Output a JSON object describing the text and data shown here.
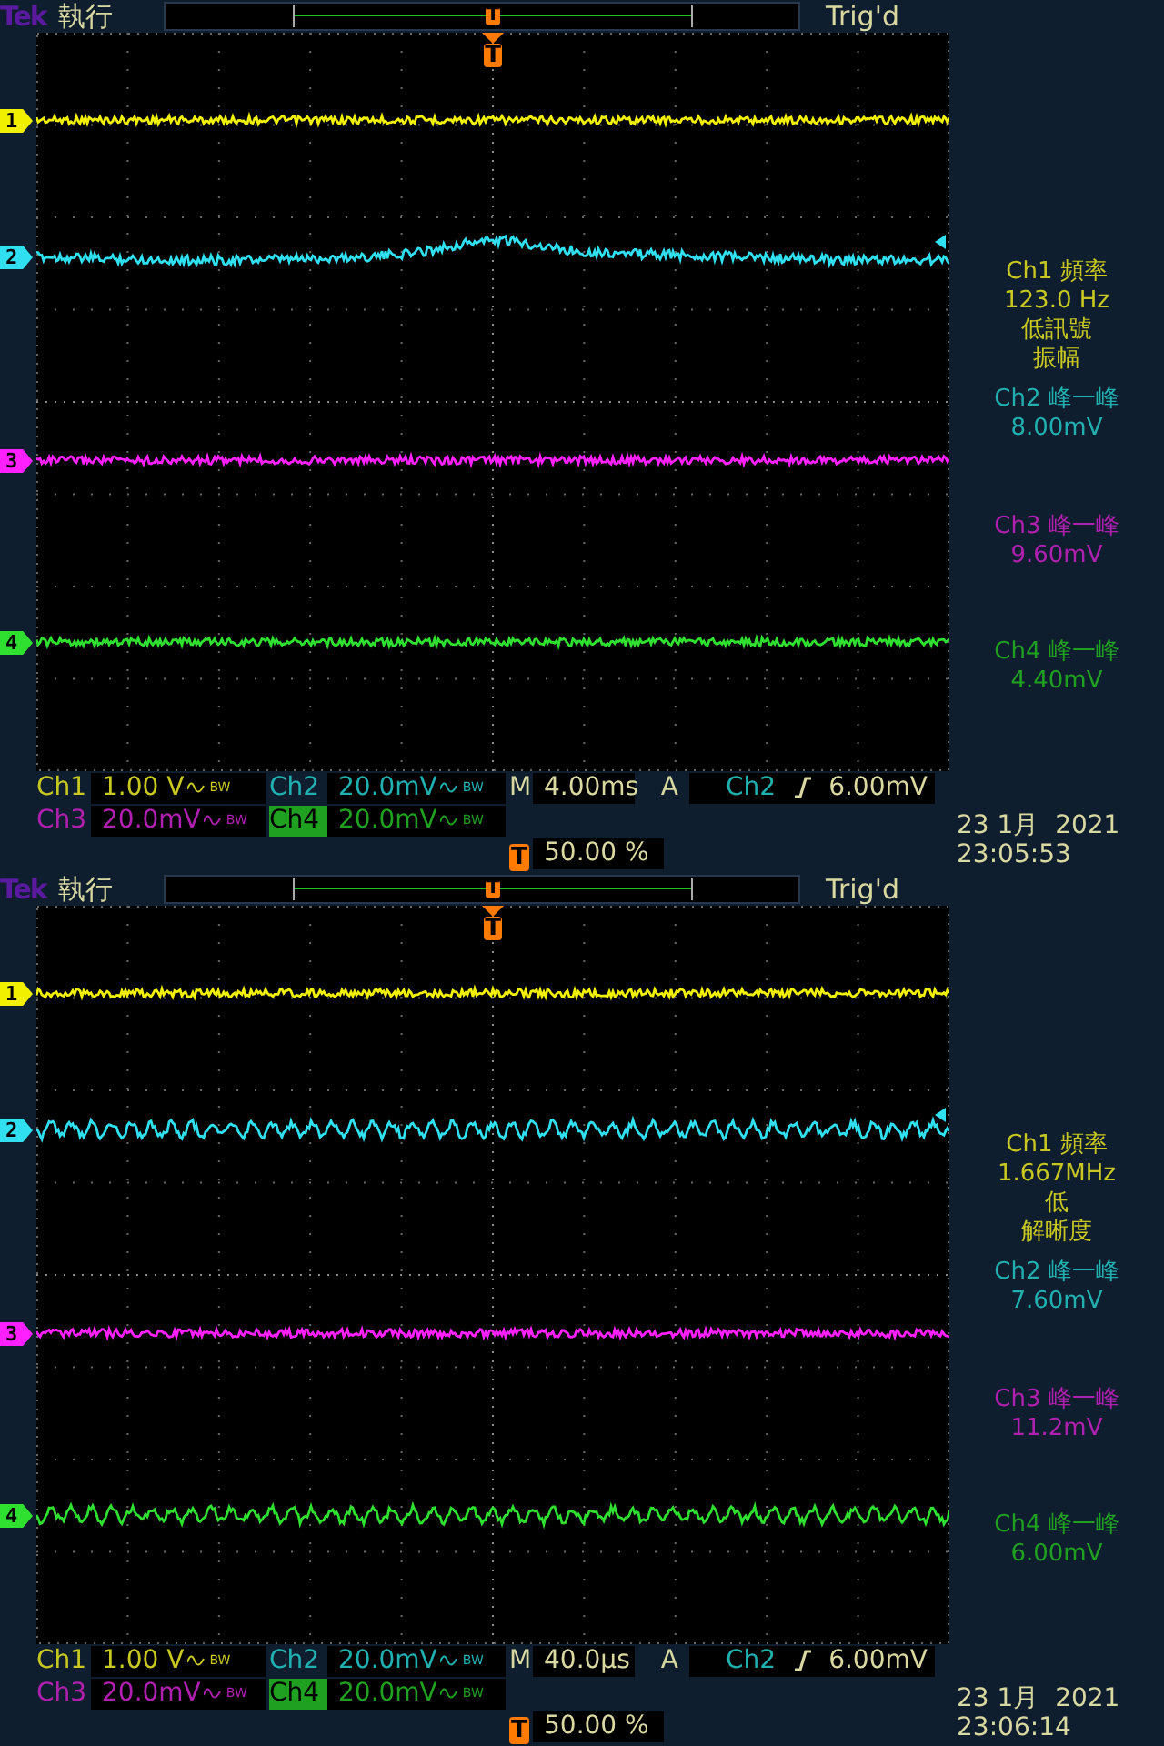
{
  "screens": [
    {
      "brand": "Tek",
      "run_state": "執行",
      "record_marker": "T",
      "trigger_status": "Trig'd",
      "trigger_marker": "T",
      "channels": [
        {
          "marker": "1",
          "color": "#f0f000",
          "kind": "noise"
        },
        {
          "marker": "2",
          "color": "#30e0f0",
          "kind": "bump"
        },
        {
          "marker": "3",
          "color": "#ff20ff",
          "kind": "noise"
        },
        {
          "marker": "4",
          "color": "#30e030",
          "kind": "noise"
        }
      ],
      "measurements": [
        {
          "color": "#c8c820",
          "lines": [
            "Ch1 頻率",
            "123.0 Hz",
            "低訊號",
            "振幅"
          ]
        },
        {
          "color": "#20b0b0",
          "lines": [
            "Ch2 峰一峰",
            "8.00mV"
          ]
        },
        {
          "color": "#b020b0",
          "lines": [
            "Ch3 峰一峰",
            "9.60mV"
          ]
        },
        {
          "color": "#20a020",
          "lines": [
            "Ch4 峰一峰",
            "4.40mV"
          ]
        }
      ],
      "readouts": [
        {
          "label": "Ch1",
          "value": "1.00 V",
          "bw": "BW",
          "color": "#c8c820",
          "selected": false
        },
        {
          "label": "Ch2",
          "value": "20.0mV",
          "bw": "BW",
          "color": "#20b0b0",
          "selected": false
        },
        {
          "label": "Ch3",
          "value": "20.0mV",
          "bw": "BW",
          "color": "#b020b0",
          "selected": false
        },
        {
          "label": "Ch4",
          "value": "20.0mV",
          "bw": "BW",
          "color": "#20a020",
          "selected": true
        }
      ],
      "timebase": {
        "label": "M",
        "value": "4.00ms"
      },
      "trigger": {
        "mode": "A",
        "source": "Ch2",
        "level": "6.00mV"
      },
      "trigger_position": {
        "icon": "T",
        "value": "50.00 %"
      },
      "date": "23 1月  2021",
      "time": "23:05:53"
    },
    {
      "brand": "Tek",
      "run_state": "執行",
      "record_marker": "T",
      "trigger_status": "Trig'd",
      "trigger_marker": "T",
      "channels": [
        {
          "marker": "1",
          "color": "#f0f000",
          "kind": "noise"
        },
        {
          "marker": "2",
          "color": "#30e0f0",
          "kind": "ripple"
        },
        {
          "marker": "3",
          "color": "#ff20ff",
          "kind": "noise"
        },
        {
          "marker": "4",
          "color": "#30e030",
          "kind": "ripple"
        }
      ],
      "measurements": [
        {
          "color": "#c8c820",
          "lines": [
            "Ch1 頻率",
            "1.667MHz",
            "低",
            "解晰度"
          ]
        },
        {
          "color": "#20b0b0",
          "lines": [
            "Ch2 峰一峰",
            "7.60mV"
          ]
        },
        {
          "color": "#b020b0",
          "lines": [
            "Ch3 峰一峰",
            "11.2mV"
          ]
        },
        {
          "color": "#20a020",
          "lines": [
            "Ch4 峰一峰",
            "6.00mV"
          ]
        }
      ],
      "readouts": [
        {
          "label": "Ch1",
          "value": "1.00 V",
          "bw": "BW",
          "color": "#c8c820",
          "selected": false
        },
        {
          "label": "Ch2",
          "value": "20.0mV",
          "bw": "BW",
          "color": "#20b0b0",
          "selected": false
        },
        {
          "label": "Ch3",
          "value": "20.0mV",
          "bw": "BW",
          "color": "#b020b0",
          "selected": false
        },
        {
          "label": "Ch4",
          "value": "20.0mV",
          "bw": "BW",
          "color": "#20a020",
          "selected": true
        }
      ],
      "timebase": {
        "label": "M",
        "value": "40.0µs"
      },
      "trigger": {
        "mode": "A",
        "source": "Ch2",
        "level": "6.00mV"
      },
      "trigger_position": {
        "icon": "T",
        "value": "50.00 %"
      },
      "date": "23 1月  2021",
      "time": "23:06:14"
    }
  ]
}
